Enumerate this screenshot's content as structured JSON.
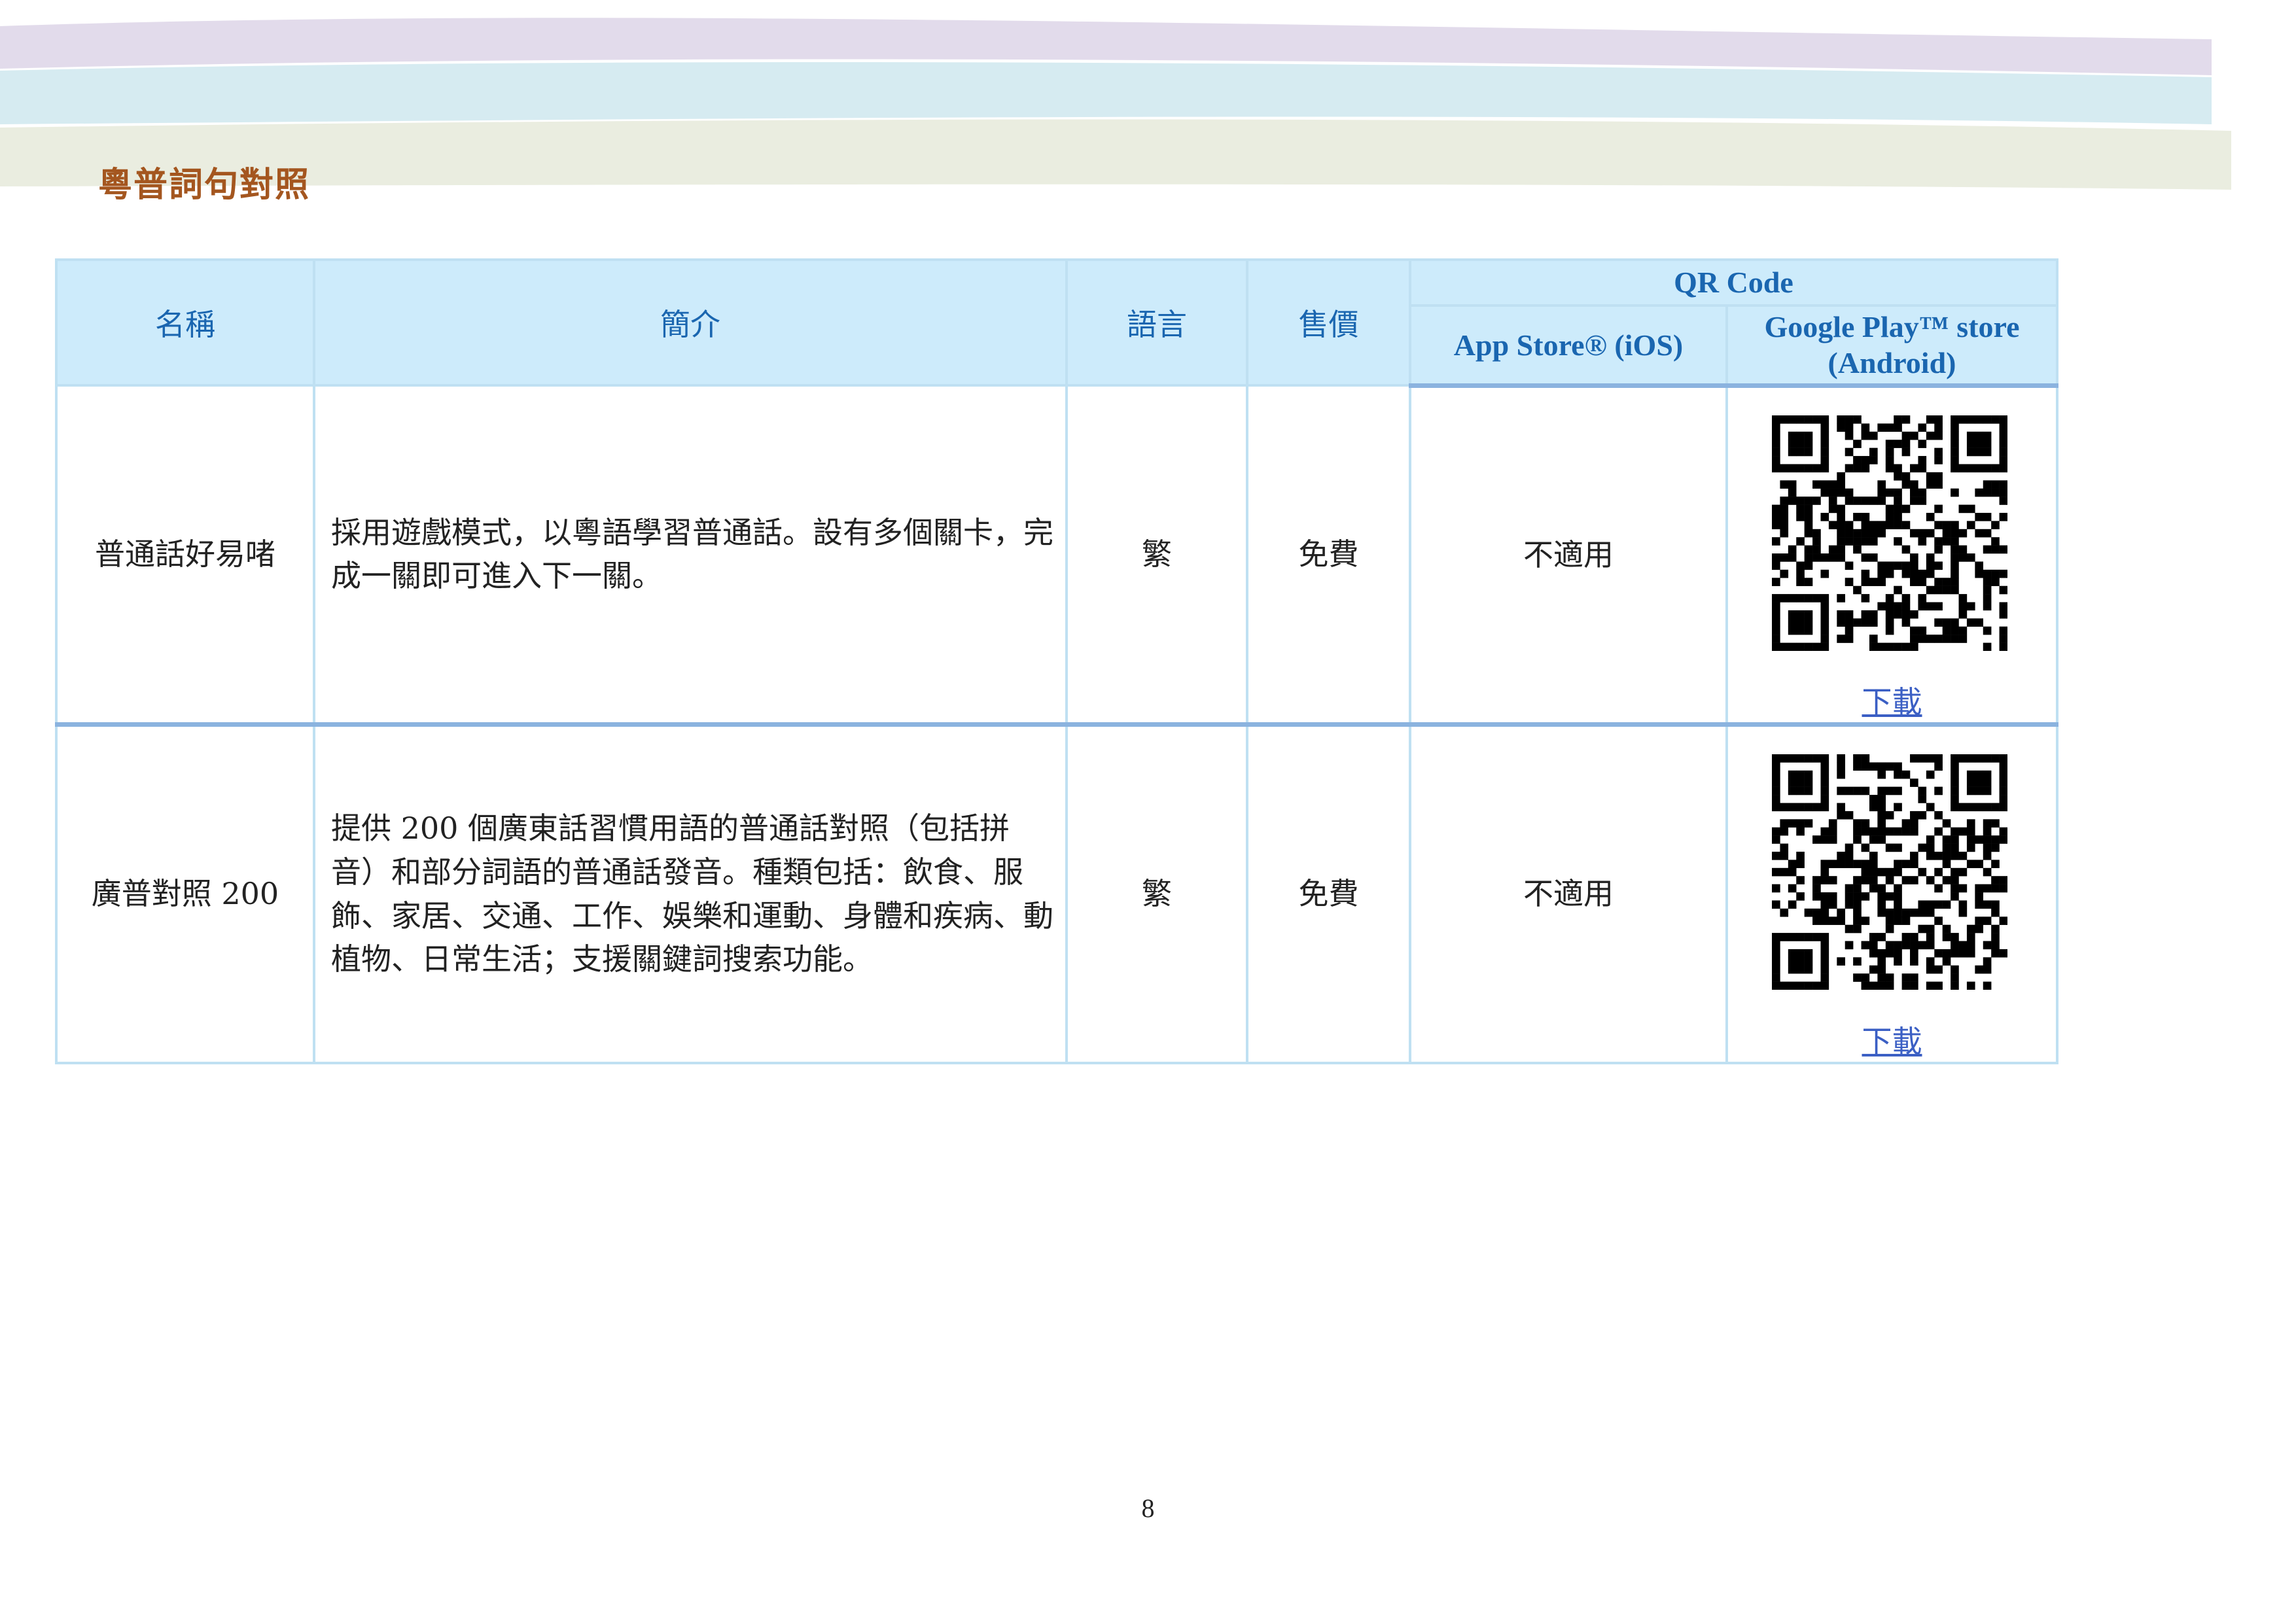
{
  "page": {
    "title": "粵普詞句對照",
    "page_number": "8"
  },
  "table": {
    "headers": {
      "name": "名稱",
      "intro": "簡介",
      "language": "語言",
      "price": "售價",
      "qr_code": "QR Code",
      "app_store": "App Store® (iOS)",
      "google_play": "Google Play™ store (Android)"
    },
    "rows": [
      {
        "name": "普通話好易啫",
        "intro": "採用遊戲模式，以粵語學習普通話。設有多個關卡，完成一關即可進入下一關。",
        "language": "繁",
        "price": "免費",
        "app_store": "不適用",
        "google_play_link": "下載"
      },
      {
        "name": "廣普對照 200",
        "intro": "提供 200 個廣東話習慣用語的普通話對照（包括拼音）和部分詞語的普通話發音。種類包括：飲食、服飾、家居、交通、工作、娛樂和運動、身體和疾病、動植物、日常生活；支援關鍵詞搜索功能。",
        "language": "繁",
        "price": "免費",
        "app_store": "不適用",
        "google_play_link": "下載"
      }
    ]
  },
  "colors": {
    "title": "#a4561f",
    "header_bg": "#cdebfb",
    "header_text": "#1a66b0",
    "border_light": "#bfe0f2",
    "border_dark": "#8bb3df",
    "link": "#3b5fc4"
  }
}
